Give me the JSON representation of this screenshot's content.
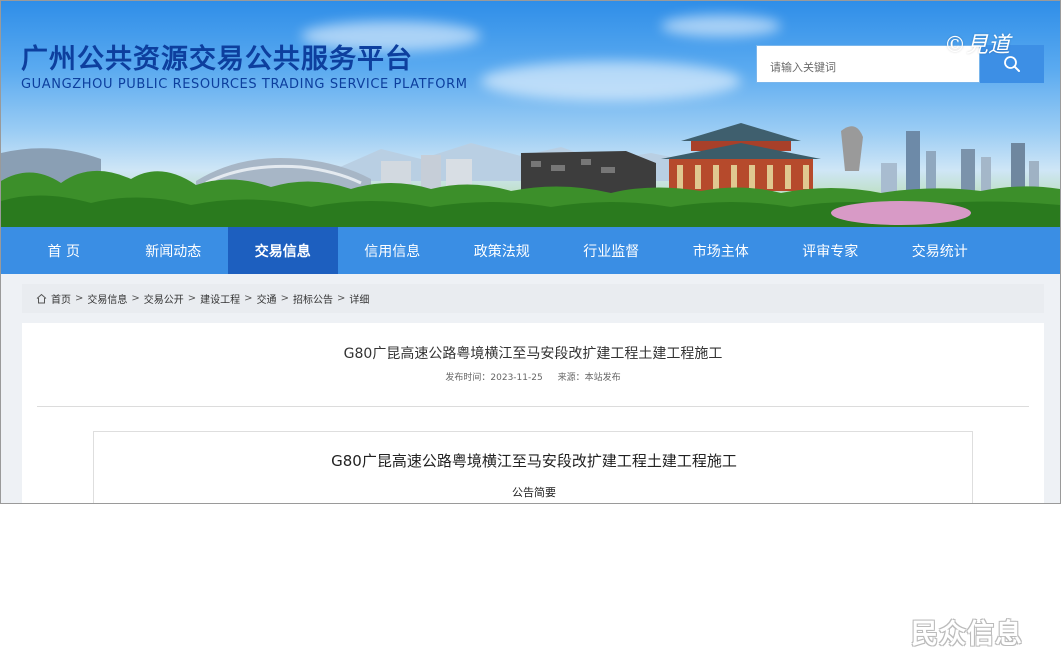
{
  "header": {
    "title": "广州公共资源交易公共服务平台",
    "subtitle": "GUANGZHOU PUBLIC RESOURCES TRADING SERVICE PLATFORM",
    "search_placeholder": "请输入关键词",
    "watermark": "©見道"
  },
  "nav": {
    "items": [
      {
        "label": "首 页"
      },
      {
        "label": "新闻动态"
      },
      {
        "label": "交易信息",
        "active": true
      },
      {
        "label": "信用信息"
      },
      {
        "label": "政策法规"
      },
      {
        "label": "行业监督"
      },
      {
        "label": "市场主体"
      },
      {
        "label": "评审专家"
      },
      {
        "label": "交易统计"
      }
    ]
  },
  "breadcrumb": {
    "items": [
      "首页",
      "交易信息",
      "交易公开",
      "建设工程",
      "交通",
      "招标公告",
      "详细"
    ],
    "separator": ">"
  },
  "article": {
    "title": "G80广昆高速公路粤境横江至马安段改扩建工程土建工程施工",
    "publish_time": "发布时间：2023-11-25",
    "source": "来源：本站发布"
  },
  "document": {
    "title": "G80广昆高速公路粤境横江至马安段改扩建工程土建工程施工",
    "section": "公告简要"
  },
  "footer_watermark": "民众信息",
  "colors": {
    "nav_bg": "#3a8ee4",
    "nav_active": "#1d5fbf",
    "title_blue": "#0d3f9e"
  }
}
